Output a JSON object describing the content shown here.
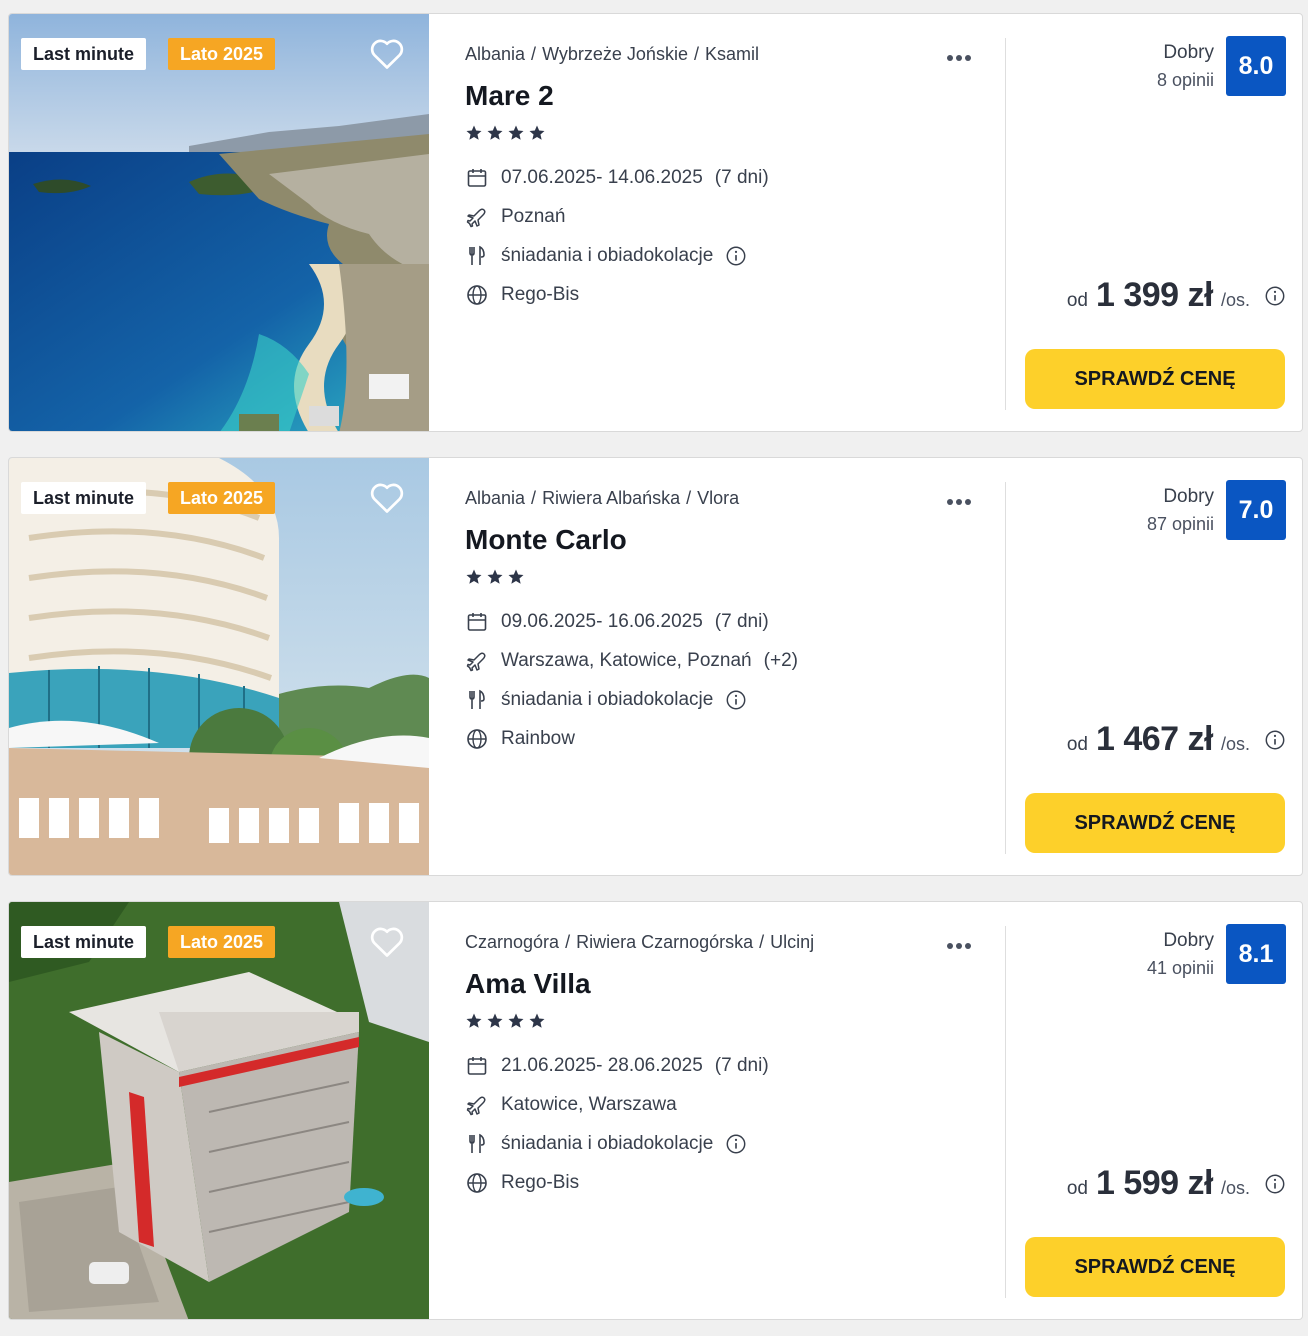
{
  "colors": {
    "rating_badge": "#0a56c2",
    "cta": "#fdd02a",
    "season_badge": "#f6a623"
  },
  "offers": [
    {
      "badge_primary": "Last minute",
      "badge_season": "Lato 2025",
      "breadcrumb": [
        "Albania",
        "Wybrzeże Jońskie",
        "Ksamil"
      ],
      "name": "Mare 2",
      "stars": 4,
      "dates": "07.06.2025- 14.06.2025",
      "duration": "(7 dni)",
      "departure": "Poznań",
      "departure_extra": "",
      "board": "śniadania i obiadokolacje",
      "operator": "Rego-Bis",
      "rating_word": "Dobry",
      "rating_count": "8 opinii",
      "rating_score": "8.0",
      "price_prefix": "od",
      "price": "1 399 zł",
      "price_suffix": "/os.",
      "cta": "SPRAWDŹ CENĘ",
      "image": "beach-bay-photo"
    },
    {
      "badge_primary": "Last minute",
      "badge_season": "Lato 2025",
      "breadcrumb": [
        "Albania",
        "Riwiera Albańska",
        "Vlora"
      ],
      "name": "Monte Carlo",
      "stars": 3,
      "dates": "09.06.2025- 16.06.2025",
      "duration": "(7 dni)",
      "departure": "Warszawa, Katowice, Poznań",
      "departure_extra": "(+2)",
      "board": "śniadania i obiadokolacje",
      "operator": "Rainbow",
      "rating_word": "Dobry",
      "rating_count": "87 opinii",
      "rating_score": "7.0",
      "price_prefix": "od",
      "price": "1 467 zł",
      "price_suffix": "/os.",
      "cta": "SPRAWDŹ CENĘ",
      "image": "round-hotel-building-photo"
    },
    {
      "badge_primary": "Last minute",
      "badge_season": "Lato 2025",
      "breadcrumb": [
        "Czarnogóra",
        "Riwiera Czarnogórska",
        "Ulcinj"
      ],
      "name": "Ama Villa",
      "stars": 4,
      "dates": "21.06.2025- 28.06.2025",
      "duration": "(7 dni)",
      "departure": "Katowice, Warszawa",
      "departure_extra": "",
      "board": "śniadania i obiadokolacje",
      "operator": "Rego-Bis",
      "rating_word": "Dobry",
      "rating_count": "41 opinii",
      "rating_score": "8.1",
      "price_prefix": "od",
      "price": "1 599 zł",
      "price_suffix": "/os.",
      "cta": "SPRAWDŹ CENĘ",
      "image": "aerial-villa-photo"
    }
  ]
}
